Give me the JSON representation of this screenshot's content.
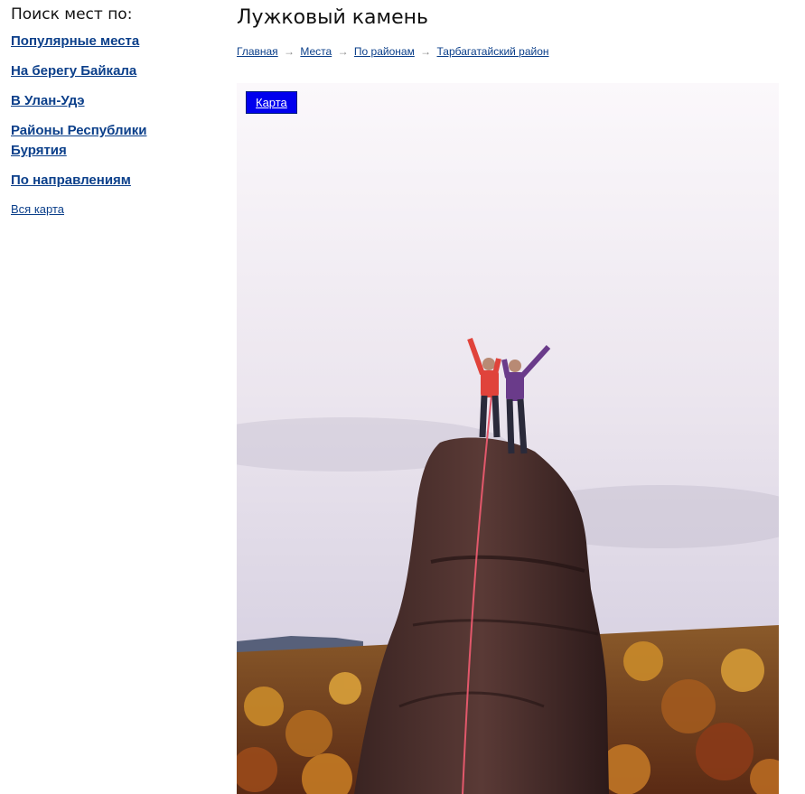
{
  "sidebar": {
    "heading": "Поиск мест по:",
    "items": [
      {
        "label": "Популярные места"
      },
      {
        "label": "На берегу Байкала"
      },
      {
        "label": "В Улан-Удэ"
      },
      {
        "label": "Районы Республики Бурятия"
      },
      {
        "label": "По направлениям"
      }
    ],
    "map_link": "Вся карта"
  },
  "page": {
    "title": "Лужковый камень"
  },
  "breadcrumb": {
    "items": [
      {
        "label": "Главная"
      },
      {
        "label": "Места"
      },
      {
        "label": "По районам"
      },
      {
        "label": "Тарбагатайский район"
      }
    ],
    "separator": "→"
  },
  "photo": {
    "map_button": "Карта"
  }
}
